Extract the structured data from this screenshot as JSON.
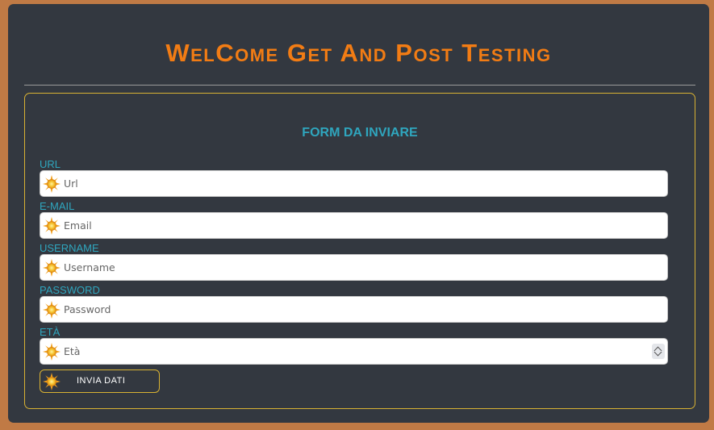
{
  "page": {
    "title": "WelCome Get And Post Testing"
  },
  "form": {
    "title": "FORM DA INVIARE",
    "fields": [
      {
        "label": "URL",
        "placeholder": "Url",
        "icon": "sun-icon"
      },
      {
        "label": "E-MAIL",
        "placeholder": "Email",
        "icon": "sun-icon"
      },
      {
        "label": "USERNAME",
        "placeholder": "Username",
        "icon": "sun-icon"
      },
      {
        "label": "PASSWORD",
        "placeholder": "Password",
        "icon": "sun-icon"
      },
      {
        "label": "ETÀ",
        "placeholder": "Età",
        "icon": "sun-icon"
      }
    ],
    "submit_label": "INVIA DATI"
  },
  "colors": {
    "background": "#333840",
    "title": "#f27c14",
    "label": "#2fa6be",
    "border_accent": "#d9b233",
    "frame": "#c07a45"
  }
}
